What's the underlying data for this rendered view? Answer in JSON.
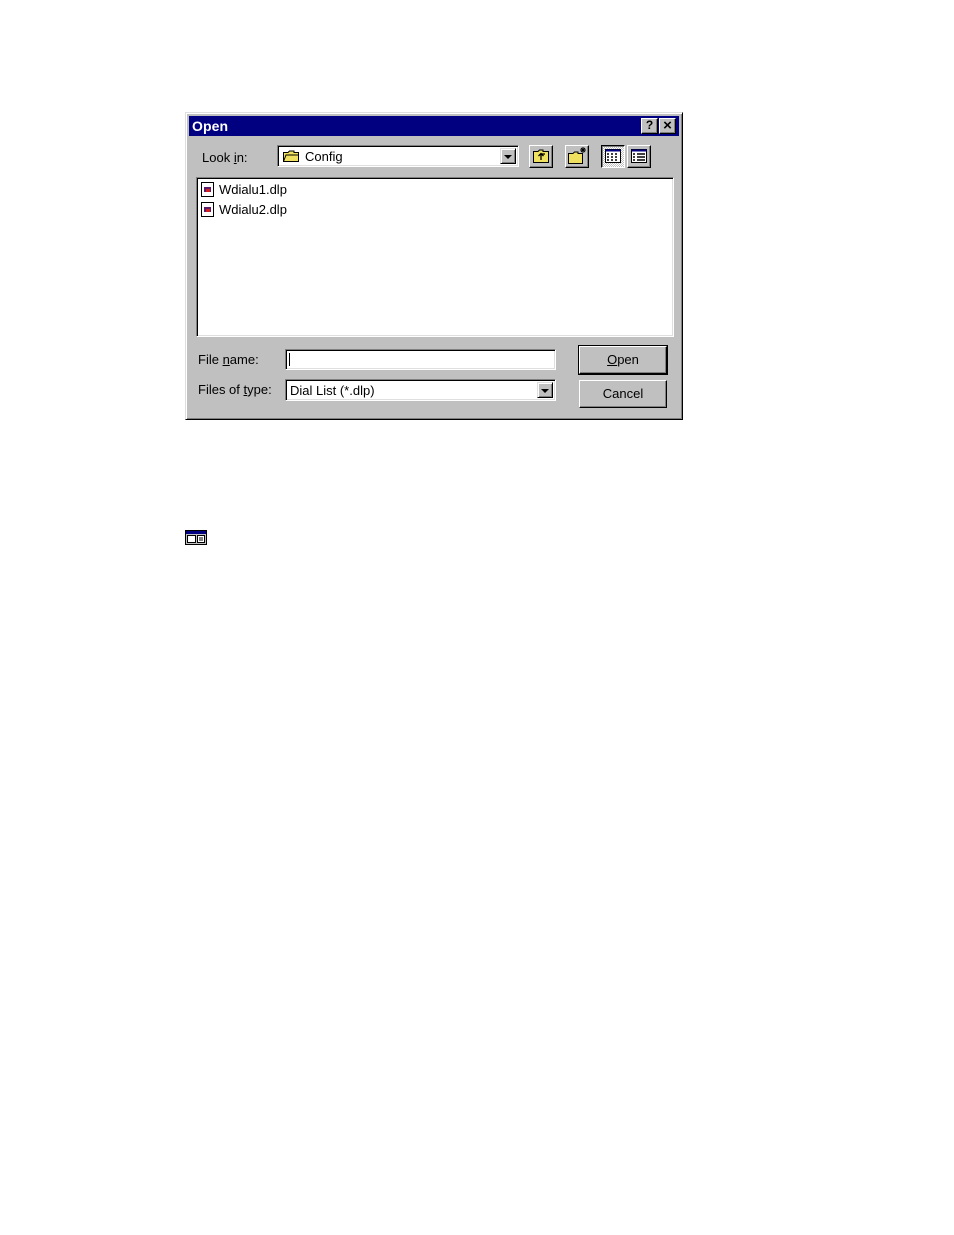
{
  "dialog": {
    "title": "Open",
    "help_label": "?",
    "close_label": "×",
    "look_in": {
      "label_pre": "Look ",
      "label_key": "i",
      "label_post": "n:",
      "value": "Config"
    },
    "toolbar": {
      "up_one_level": "up-folder-icon",
      "create_new_folder": "new-folder-icon",
      "list_view": "list-view-icon",
      "details_view": "details-view-icon"
    },
    "files": [
      "Wdialu1.dlp",
      "Wdialu2.dlp"
    ],
    "file_name": {
      "label_pre": "File ",
      "label_key": "n",
      "label_post": "ame:",
      "value": ""
    },
    "files_of_type": {
      "label_pre": "Files of ",
      "label_key": "t",
      "label_post": "ype:",
      "value": "Dial List (*.dlp)"
    },
    "open_button": {
      "key": "O",
      "rest": "pen"
    },
    "cancel_button": "Cancel"
  },
  "colors": {
    "titlebar": "#000080",
    "face": "#c0c0c0",
    "folder": "#f0e060"
  }
}
